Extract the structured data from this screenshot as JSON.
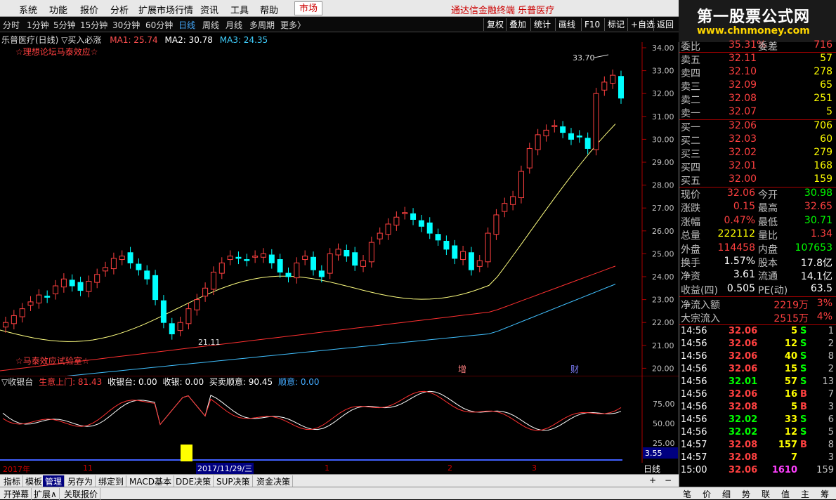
{
  "menu": {
    "items": [
      "系统",
      "功能",
      "报价",
      "分析",
      "扩展市场行情",
      "资讯",
      "工具",
      "帮助"
    ],
    "market_button": "市场",
    "center_title": "通达信金融终端  乐普医疗"
  },
  "brand": {
    "name": "第一股票公式网",
    "url": "www.chnmoney.com"
  },
  "periods": [
    "分时",
    "1分钟",
    "5分钟",
    "15分钟",
    "30分钟",
    "60分钟",
    "日线",
    "周线",
    "月线",
    "多周期",
    "更多〉"
  ],
  "active_period": "日线",
  "toolbar": [
    "复权",
    "叠加",
    "统计",
    "画线",
    "F10",
    "标记",
    "+自选",
    "返回"
  ],
  "chart_info": {
    "title": "乐普医疗(日线) ▽买入必涨",
    "ma1": "MA1: 25.74",
    "ma2": "MA2: 30.78",
    "ma3": "MA3: 24.35",
    "note_top": "☆理想论坛马泰效应☆",
    "note_bottom": "☆马泰效应试验室☆",
    "high_label": "33.70",
    "low_label": "21.11",
    "marker_zeng": "增",
    "marker_cai": "财"
  },
  "price_axis": [
    "34.00",
    "33.00",
    "32.00",
    "31.00",
    "30.00",
    "29.00",
    "28.00",
    "27.00",
    "26.00",
    "25.00",
    "24.00",
    "23.00",
    "22.00",
    "21.00",
    "20.00"
  ],
  "indicator": {
    "name": "▽收银台",
    "s1": "生意上门: 81.43",
    "s2": "收银台: 0.00",
    "s3": "收银: 0.00",
    "s4": "买卖顺意: 90.45",
    "s5": "顺意: 0.00",
    "axis": [
      "75.00",
      "50.00",
      "25.00"
    ],
    "current": "3.55"
  },
  "dates": {
    "year": "2017年",
    "m11": "11",
    "selected": "2017/11/29/三",
    "m1": "1",
    "m2": "2",
    "m3": "3"
  },
  "bottom_tabs1": [
    "指标",
    "模板",
    "管理",
    "另存为",
    "绑定到",
    "MACD基本",
    "DDE决策",
    "SUP决策",
    "资金决策"
  ],
  "bottom_tabs2": [
    "开弹幕",
    "扩展∧",
    "关联报价"
  ],
  "daily_button": "日线",
  "order_book": {
    "weibi": {
      "label": "委比",
      "value": "35.31%",
      "label2": "委差",
      "value2": "716"
    },
    "asks": [
      {
        "label": "卖五",
        "price": "32.11",
        "vol": "57"
      },
      {
        "label": "卖四",
        "price": "32.10",
        "vol": "278"
      },
      {
        "label": "卖三",
        "price": "32.09",
        "vol": "65"
      },
      {
        "label": "卖二",
        "price": "32.08",
        "vol": "251"
      },
      {
        "label": "卖一",
        "price": "32.07",
        "vol": "5"
      }
    ],
    "bids": [
      {
        "label": "买一",
        "price": "32.06",
        "vol": "706"
      },
      {
        "label": "买二",
        "price": "32.03",
        "vol": "60"
      },
      {
        "label": "买三",
        "price": "32.02",
        "vol": "279"
      },
      {
        "label": "买四",
        "price": "32.01",
        "vol": "168"
      },
      {
        "label": "买五",
        "price": "32.00",
        "vol": "159"
      }
    ]
  },
  "quote": [
    {
      "l1": "现价",
      "v1": "32.06",
      "l2": "今开",
      "v2": "30.98",
      "c1": "red",
      "c2": "green"
    },
    {
      "l1": "涨跌",
      "v1": "0.15",
      "l2": "最高",
      "v2": "32.65",
      "c1": "red",
      "c2": "red"
    },
    {
      "l1": "涨幅",
      "v1": "0.47%",
      "l2": "最低",
      "v2": "30.71",
      "c1": "red",
      "c2": "green"
    },
    {
      "l1": "总量",
      "v1": "222112",
      "l2": "量比",
      "v2": "1.34",
      "c1": "yellow",
      "c2": "red"
    },
    {
      "l1": "外盘",
      "v1": "114458",
      "l2": "内盘",
      "v2": "107653",
      "c1": "red",
      "c2": "green"
    },
    {
      "l1": "换手",
      "v1": "1.57%",
      "l2": "股本",
      "v2": "17.8亿",
      "c1": "white",
      "c2": "white"
    },
    {
      "l1": "净资",
      "v1": "3.61",
      "l2": "流通",
      "v2": "14.1亿",
      "c1": "white",
      "c2": "white"
    },
    {
      "l1": "收益(四)",
      "v1": "0.505",
      "l2": "PE(动)",
      "v2": "63.5",
      "c1": "white",
      "c2": "white"
    }
  ],
  "flows": [
    {
      "label": "净流入额",
      "value": "2219万",
      "pct": "3%"
    },
    {
      "label": "大宗流入",
      "value": "2515万",
      "pct": "4%"
    }
  ],
  "ticks": [
    {
      "t": "14:56",
      "p": "32.06",
      "v": "5",
      "s": "S",
      "n": "1"
    },
    {
      "t": "14:56",
      "p": "32.06",
      "v": "12",
      "s": "S",
      "n": "2"
    },
    {
      "t": "14:56",
      "p": "32.06",
      "v": "40",
      "s": "S",
      "n": "8"
    },
    {
      "t": "14:56",
      "p": "32.06",
      "v": "15",
      "s": "S",
      "n": "2"
    },
    {
      "t": "14:56",
      "p": "32.01",
      "v": "57",
      "s": "S",
      "n": "13"
    },
    {
      "t": "14:56",
      "p": "32.06",
      "v": "16",
      "s": "B",
      "n": "7"
    },
    {
      "t": "14:56",
      "p": "32.08",
      "v": "5",
      "s": "B",
      "n": "3"
    },
    {
      "t": "14:56",
      "p": "32.02",
      "v": "33",
      "s": "S",
      "n": "6"
    },
    {
      "t": "14:56",
      "p": "32.02",
      "v": "12",
      "s": "S",
      "n": "5"
    },
    {
      "t": "14:57",
      "p": "32.08",
      "v": "157",
      "s": "B",
      "n": "8"
    },
    {
      "t": "14:57",
      "p": "32.08",
      "v": "7",
      "s": "",
      "n": "3"
    },
    {
      "t": "15:00",
      "p": "32.06",
      "v": "1610",
      "s": "",
      "n": "159"
    }
  ],
  "right_tabs": [
    "笔",
    "价",
    "细",
    "势",
    "联",
    "值",
    "主",
    "筹"
  ],
  "colors": {
    "up": "#ff4040",
    "down": "#00ffff",
    "signal": "#ff40ff",
    "ma_yellow": "#ffff80",
    "ma_red": "#ff3030",
    "ma_cyan": "#40c0ff"
  }
}
